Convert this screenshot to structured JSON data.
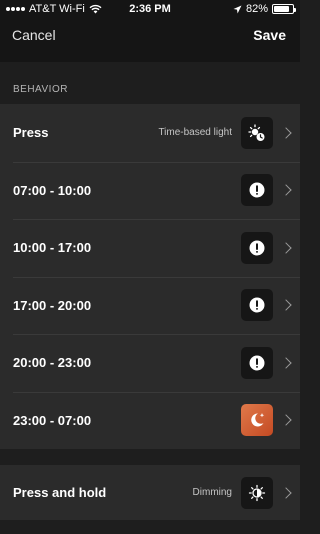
{
  "status_bar": {
    "carrier": "AT&T Wi-Fi",
    "time": "2:36 PM",
    "battery": "82%",
    "battery_level": 0.82
  },
  "nav": {
    "cancel_label": "Cancel",
    "save_label": "Save"
  },
  "section": {
    "title": "BEHAVIOR"
  },
  "rows": [
    {
      "label": "Press",
      "value": "Time-based light",
      "icon": "time-based-light-icon"
    },
    {
      "label": "07:00 - 10:00",
      "icon": "scene-icon"
    },
    {
      "label": "10:00 - 17:00",
      "icon": "scene-icon"
    },
    {
      "label": "17:00 - 20:00",
      "icon": "scene-icon"
    },
    {
      "label": "20:00 - 23:00",
      "icon": "scene-icon"
    },
    {
      "label": "23:00 - 07:00",
      "icon": "moon-star-icon",
      "color": "#d0592e"
    }
  ],
  "hold_row": {
    "label": "Press and hold",
    "value": "Dimming",
    "icon": "dimming-icon"
  }
}
